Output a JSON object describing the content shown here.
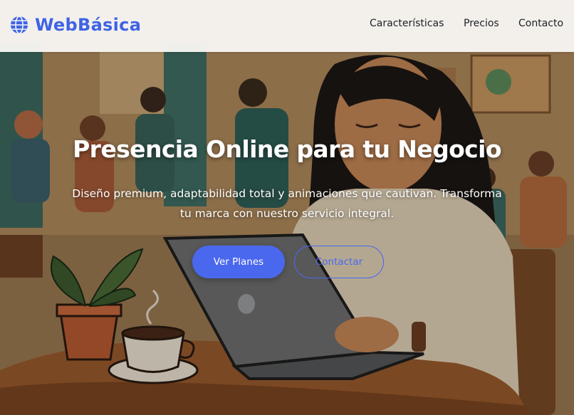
{
  "brand": {
    "name": "WebBásica",
    "color": "#3f63e6",
    "icon": "globe-icon"
  },
  "nav": {
    "links": [
      {
        "label": "Características"
      },
      {
        "label": "Precios"
      },
      {
        "label": "Contacto"
      }
    ]
  },
  "hero": {
    "title": "Presencia Online para tu Negocio",
    "subtitle_line1": "Diseño premium, adaptabilidad total y animaciones que cautivan. Transforma",
    "subtitle_line2": "tu marca con nuestro servicio integral.",
    "primary_button": "Ver Planes",
    "secondary_button": "Contactar",
    "accent_color": "#4a68ee",
    "background_image": "illustration of a woman working on a laptop in a cafe with a coffee cup and plant"
  }
}
